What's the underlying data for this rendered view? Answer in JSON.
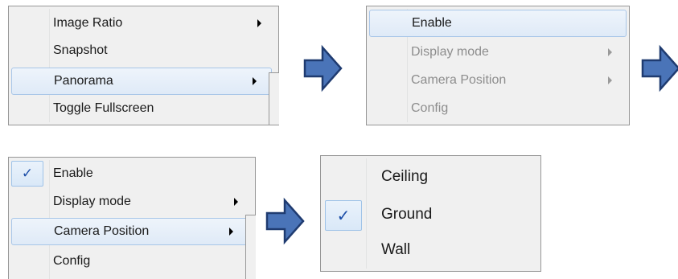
{
  "menu1": {
    "items": [
      {
        "label": "Image Ratio",
        "submenu": true
      },
      {
        "label": "Snapshot",
        "submenu": false
      },
      {
        "label": "Panorama",
        "submenu": true,
        "highlighted": true
      },
      {
        "label": "Toggle Fullscreen",
        "submenu": false
      }
    ]
  },
  "menu2": {
    "items": [
      {
        "label": "Enable",
        "highlighted": true
      },
      {
        "label": "Display mode",
        "submenu": true,
        "disabled": true
      },
      {
        "label": "Camera Position",
        "submenu": true,
        "disabled": true
      },
      {
        "label": "Config",
        "disabled": true
      }
    ]
  },
  "menu3": {
    "items": [
      {
        "label": "Enable",
        "checked": true
      },
      {
        "label": "Display mode",
        "submenu": true
      },
      {
        "label": "Camera Position",
        "submenu": true,
        "highlighted": true
      },
      {
        "label": "Config"
      }
    ]
  },
  "menu4": {
    "items": [
      {
        "label": "Ceiling"
      },
      {
        "label": "Ground",
        "checked": true
      },
      {
        "label": "Wall"
      }
    ]
  },
  "icons": {
    "check": "✓",
    "flow_arrow": "right-arrow-icon",
    "submenu_arrow": "chevron-right-icon"
  },
  "colors": {
    "flow_arrow_fill": "#4a74b8",
    "flow_arrow_stroke": "#1f3b70",
    "check": "#1c4ea8",
    "highlight_border": "#a8c6e8"
  }
}
